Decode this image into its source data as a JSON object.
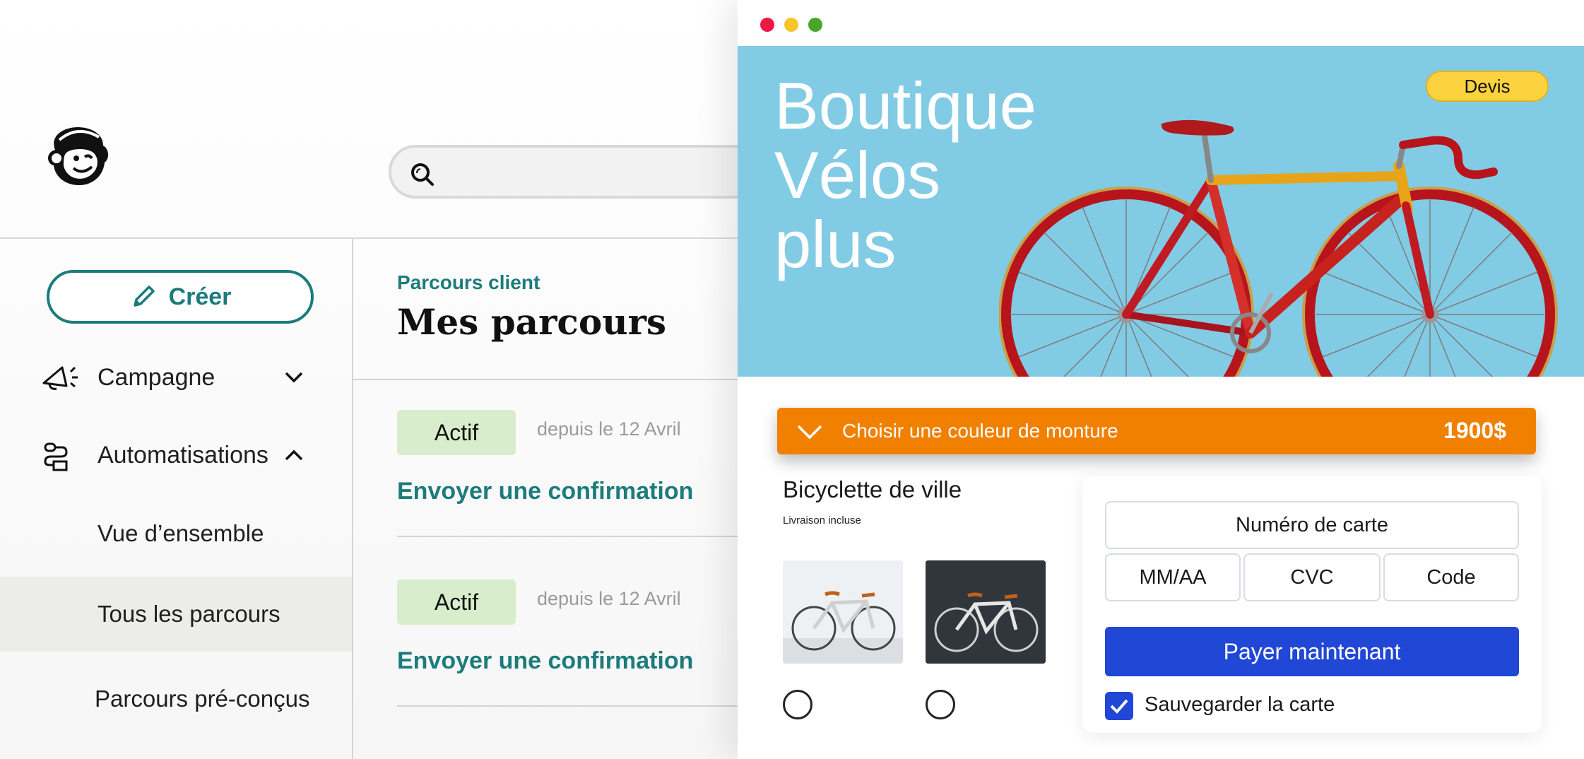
{
  "app": {
    "logo_icon": "mailchimp-freddie-icon",
    "search": {
      "icon": "search-icon",
      "placeholder": ""
    },
    "sidebar": {
      "create_label": "Créer",
      "items": [
        {
          "label": "Campagne",
          "icon": "megaphone-icon",
          "chevron": "chevron-down-icon"
        },
        {
          "label": "Automatisations",
          "icon": "automation-icon",
          "chevron": "chevron-up-icon"
        }
      ],
      "sub_items": [
        {
          "label": "Vue d’ensemble",
          "active": false
        },
        {
          "label": "Tous les parcours",
          "active": true
        },
        {
          "label": "Parcours pré-conçus",
          "active": false
        }
      ]
    },
    "main": {
      "eyebrow": "Parcours client",
      "title": "Mes parcours",
      "journeys": [
        {
          "status": "Actif",
          "since": "depuis le 12 Avril",
          "title": "Envoyer une confirmation"
        },
        {
          "status": "Actif",
          "since": "depuis le 12 Avril",
          "title": "Envoyer une confirmation"
        }
      ]
    },
    "colors": {
      "brand_teal": "#1d7b7b",
      "active_badge": "#d8edcc"
    }
  },
  "shop": {
    "window_controls": [
      "close",
      "minimize",
      "maximize"
    ],
    "hero": {
      "title_lines": [
        "Boutique",
        "Vélos",
        "plus"
      ],
      "quote_button": "Devis"
    },
    "color_selector": {
      "label": "Choisir une couleur de monture",
      "price": "1900$"
    },
    "product": {
      "name": "Bicyclette de ville",
      "subtitle": "Livraison incluse",
      "variants": [
        "white-bike-thumbnail",
        "dark-bike-thumbnail"
      ]
    },
    "payment": {
      "card_number_placeholder": "Numéro de carte",
      "expiry_placeholder": "MM/AA",
      "cvc_placeholder": "CVC",
      "code_placeholder": "Code",
      "pay_button": "Payer maintenant",
      "save_card_label": "Sauvegarder la carte",
      "save_card_checked": true
    },
    "colors": {
      "hero_bg": "#82cbe5",
      "accent_orange": "#f28000",
      "pay_blue": "#2147d6",
      "quote_yellow": "#fcd23e"
    }
  }
}
